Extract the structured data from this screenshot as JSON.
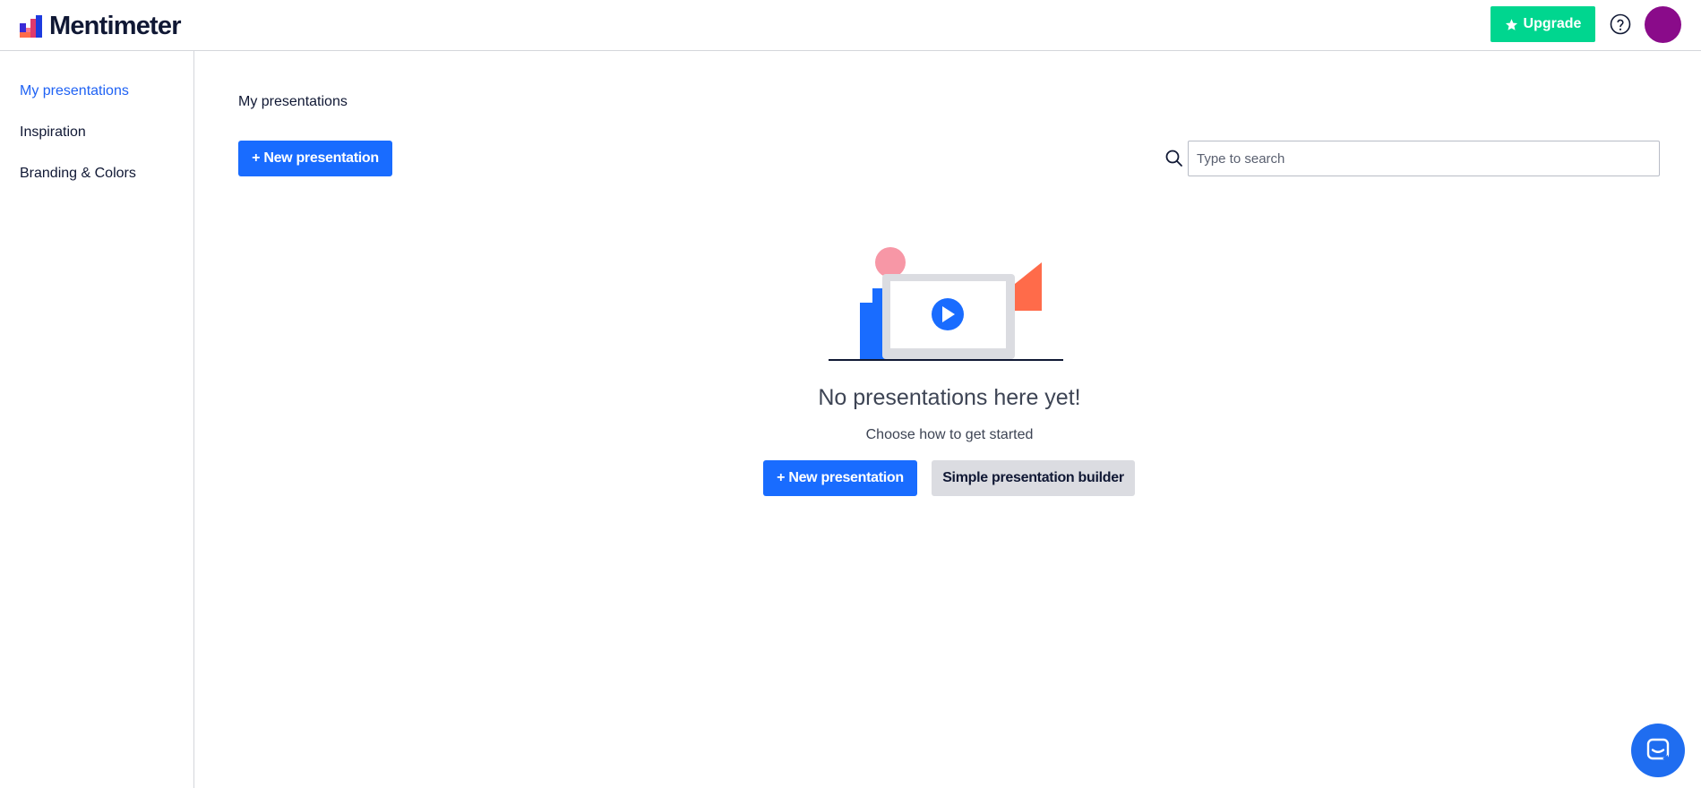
{
  "app": {
    "logo_text": "Mentimeter",
    "brand_colors": {
      "primary": "#196cff",
      "upgrade": "#00d68f",
      "avatar": "#8a0b8a"
    }
  },
  "header": {
    "upgrade_label": "Upgrade",
    "upgrade_icon": "star-icon",
    "help_icon": "help-circle-icon"
  },
  "sidebar": {
    "items": [
      {
        "label": "My presentations",
        "active": true
      },
      {
        "label": "Inspiration",
        "active": false
      },
      {
        "label": "Branding & Colors",
        "active": false
      }
    ]
  },
  "main": {
    "title": "My presentations",
    "new_presentation_label": "+ New presentation",
    "search": {
      "placeholder": "Type to search",
      "value": ""
    },
    "empty_state": {
      "title": "No presentations here yet!",
      "subtitle": "Choose how to get started",
      "new_presentation_label": "+ New presentation",
      "builder_label": "Simple presentation builder"
    }
  },
  "chat": {
    "icon": "chat-icon"
  }
}
